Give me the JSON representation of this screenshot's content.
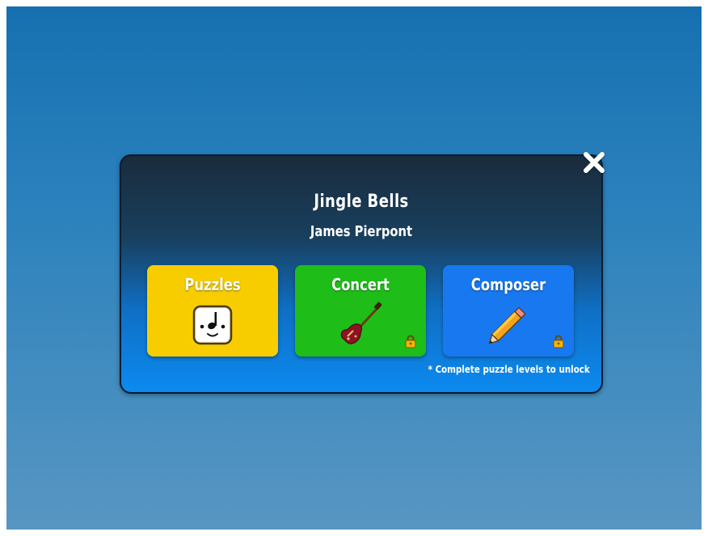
{
  "song": {
    "title": "Jingle Bells",
    "author": "James Pierpont"
  },
  "modes": [
    {
      "label": "Puzzles",
      "icon": "music-note-face-icon",
      "locked": false,
      "color": "#f7cd00"
    },
    {
      "label": "Concert",
      "icon": "electric-guitar-icon",
      "locked": true,
      "color": "#1fbd17"
    },
    {
      "label": "Composer",
      "icon": "pencil-icon",
      "locked": true,
      "color": "#1778f0"
    }
  ],
  "note": "* Complete puzzle levels to unlock",
  "close_icon": "close-icon",
  "colors": {
    "background": "#2c82bd",
    "dialog_bottom": "#0c8af0",
    "dialog_top": "#1a2b3c"
  }
}
